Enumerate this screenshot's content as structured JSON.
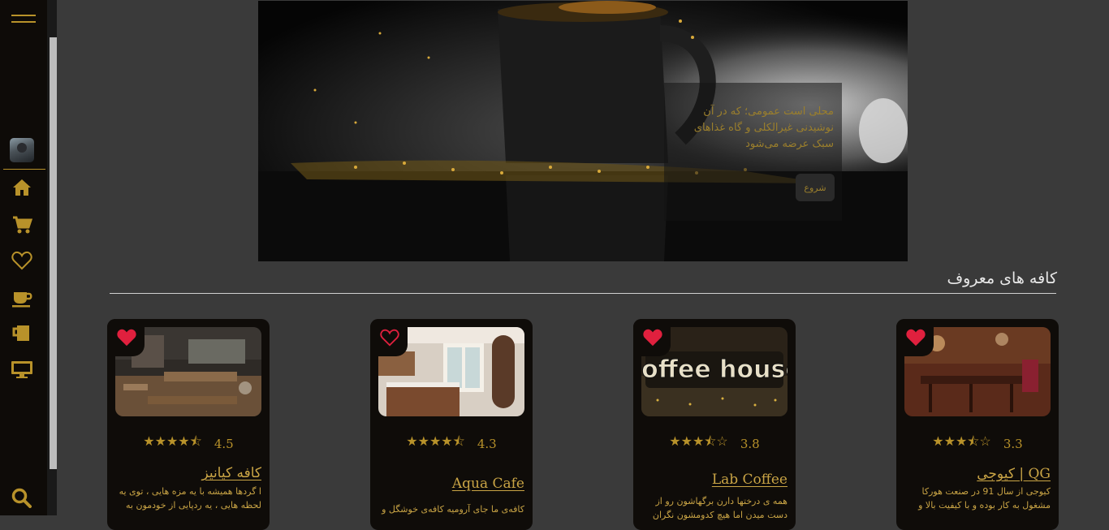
{
  "colors": {
    "accent": "#b8922a",
    "background": "#3a3a3a",
    "sidebar": "#0e0b08",
    "heart": "#e0203e"
  },
  "sidebar": {
    "icons": [
      "menu-icon",
      "avatar",
      "home-icon",
      "cart-icon",
      "heart-icon",
      "coffee-cup-icon",
      "mug-icon",
      "monitor-icon",
      "search-icon"
    ]
  },
  "hero": {
    "text": "محلی است عمومی؛ که در آن نوشیدنی غیرالکلی و گاه غذاهای سبک عرضه می‌شود",
    "button_label": "شروع"
  },
  "section": {
    "title": "کافه های معروف"
  },
  "cards": [
    {
      "title": "QG | کیوجی",
      "rating": "3.3",
      "stars": 3.5,
      "liked": true,
      "description": "کیوجی از سال 91 در صنعت هورکا مشغول به کار بوده و با کیفیت بالا و"
    },
    {
      "title": "Lab Coffee",
      "rating": "3.8",
      "stars": 3.5,
      "liked": true,
      "description": "همه ی درختها دارن برگهاشون رو از دست میدن اما هیچ کدومشون نگران"
    },
    {
      "title": "Aqua Cafe",
      "rating": "4.3",
      "stars": 4.5,
      "liked": false,
      "description": "کافه‌ی ما جای آرومیه کافه‌ی خوشگل و"
    },
    {
      "title": "کافه کیانیز",
      "rating": "4.5",
      "stars": 4.5,
      "liked": true,
      "description": "ا گردها همیشه با یه مزه هایی ، توی یه لحظه هایی ، یه ردپایی از خودمون به"
    }
  ]
}
